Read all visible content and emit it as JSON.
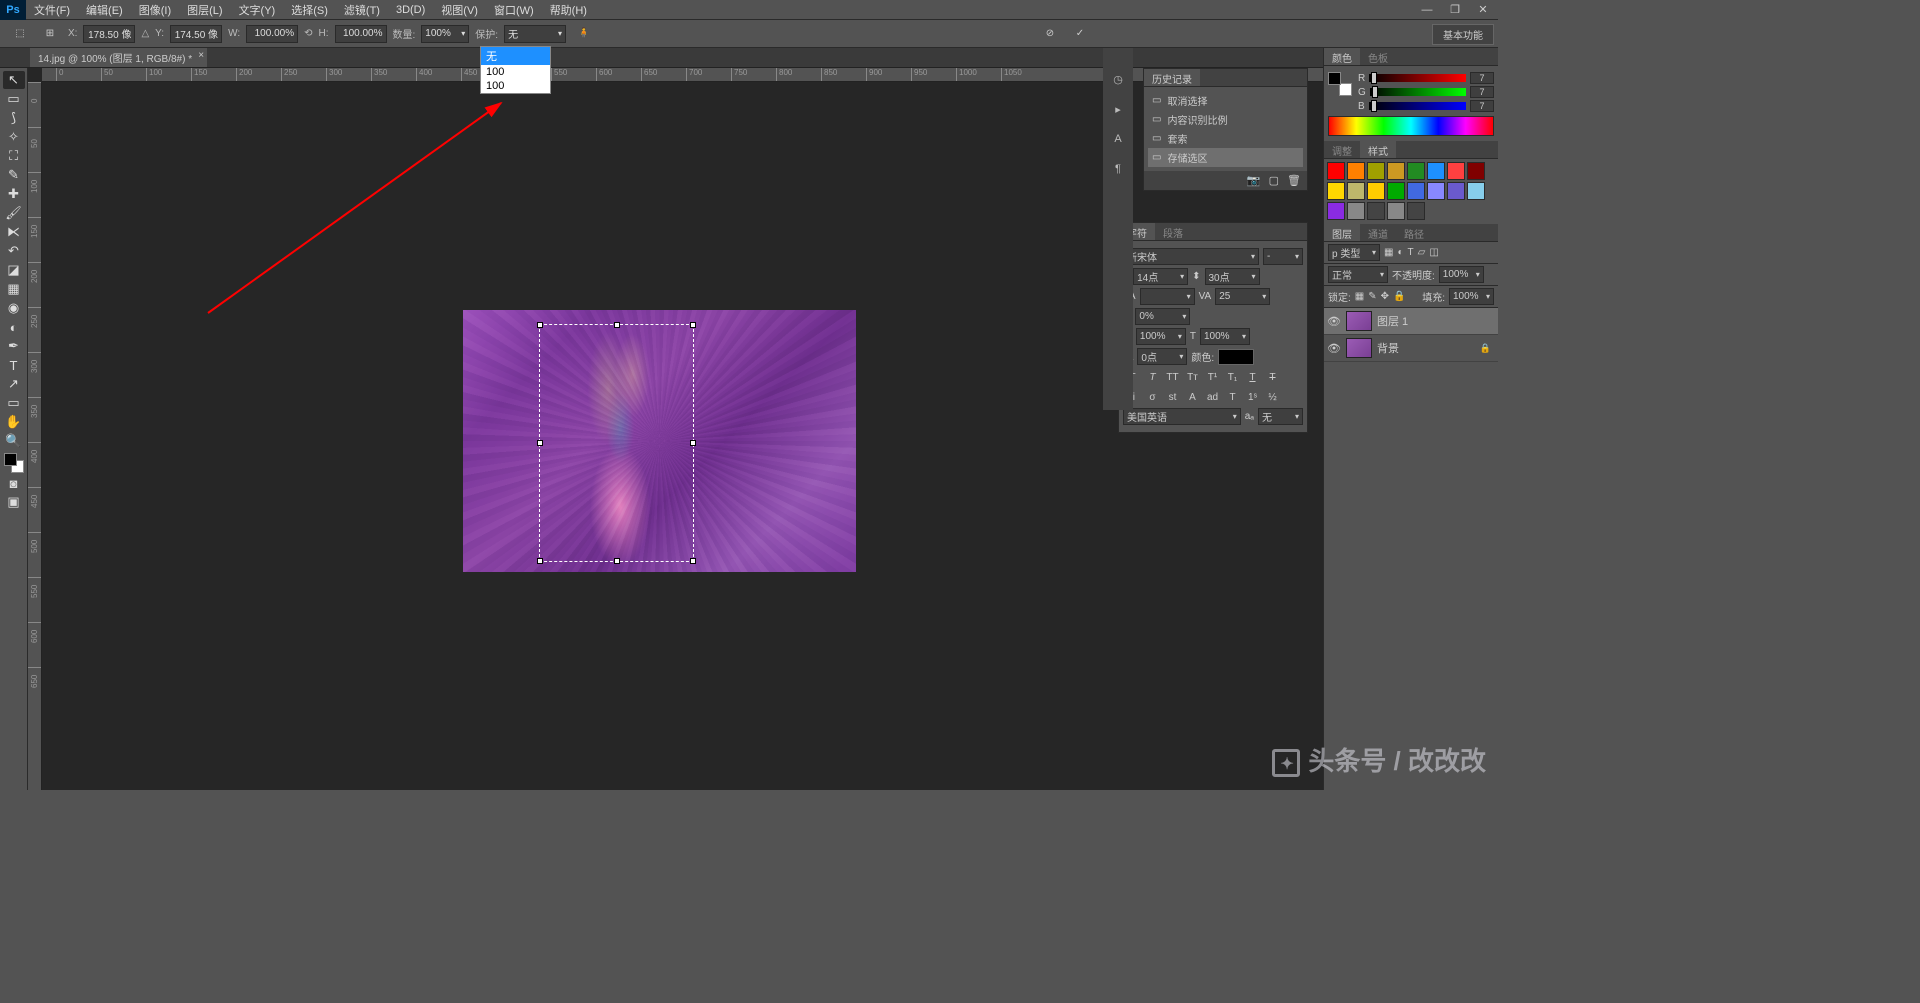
{
  "menubar": [
    "文件(F)",
    "编辑(E)",
    "图像(I)",
    "图层(L)",
    "文字(Y)",
    "选择(S)",
    "滤镜(T)",
    "3D(D)",
    "视图(V)",
    "窗口(W)",
    "帮助(H)"
  ],
  "basic_fn": "基本功能",
  "options": {
    "x_label": "X:",
    "x": "178.50 像",
    "y_label": "Y:",
    "y": "174.50 像",
    "w_label": "W:",
    "w": "100.00%",
    "h_label": "H:",
    "h": "100.00%",
    "amount_label": "数量:",
    "amount": "100%",
    "protect_label": "保护:",
    "protect": "无",
    "dropdown_options": [
      "无",
      "100",
      "100"
    ]
  },
  "doc_tab": "14.jpg @ 100% (图层 1, RGB/8#) *",
  "ruler_h": [
    "0",
    "50",
    "100",
    "150",
    "200",
    "250",
    "300",
    "350",
    "400",
    "450",
    "500",
    "550",
    "600",
    "650",
    "700",
    "750",
    "800",
    "850",
    "900",
    "950",
    "1000",
    "1050"
  ],
  "ruler_v": [
    "0",
    "50",
    "100",
    "150",
    "200",
    "250",
    "300",
    "350",
    "400",
    "450",
    "500",
    "550",
    "600",
    "650"
  ],
  "history": {
    "tab": "历史记录",
    "items": [
      "取消选择",
      "内容识别比例",
      "套索",
      "存储选区"
    ]
  },
  "character": {
    "tab1": "字符",
    "tab2": "段落",
    "font": "新宋体",
    "style": "-",
    "size": "14点",
    "leading": "30点",
    "va": "VA",
    "vaval": "",
    "kern": "VA",
    "kernval": "25",
    "height": "0%",
    "color_label": "颜色:",
    "scale": "100%",
    "baseline": "0点",
    "scalew": "100%",
    "lang": "美国英语",
    "aa": "无",
    "aalabel": "aₐ"
  },
  "color_panel": {
    "tab1": "颜色",
    "tab2": "色板",
    "r": "7",
    "g": "7",
    "b": "7"
  },
  "adjust_panel": {
    "tab1": "调整",
    "tab2": "样式"
  },
  "layers_panel": {
    "tab1": "图层",
    "tab2": "通道",
    "tab3": "路径",
    "filter": "p 类型",
    "mode": "正常",
    "opacity_label": "不透明度:",
    "opacity": "100%",
    "lock_label": "锁定:",
    "fill_label": "填充:",
    "fill": "100%",
    "layers": [
      {
        "name": "图层 1",
        "locked": false
      },
      {
        "name": "背景",
        "locked": true
      }
    ]
  },
  "swatches": [
    "#ff0000",
    "#ff8000",
    "#a0a000",
    "#cc9922",
    "#228b22",
    "#1e90ff",
    "#ff4040",
    "#800000",
    "#ffd700",
    "#bdb76b",
    "#ffcc00",
    "#00aa00",
    "#4169e1",
    "#8888ff",
    "#6a5acd",
    "#87ceeb",
    "#8a2be2",
    "#888888",
    "#444444",
    "#888888",
    "#444444"
  ],
  "watermark": "头条号 / 改改改"
}
